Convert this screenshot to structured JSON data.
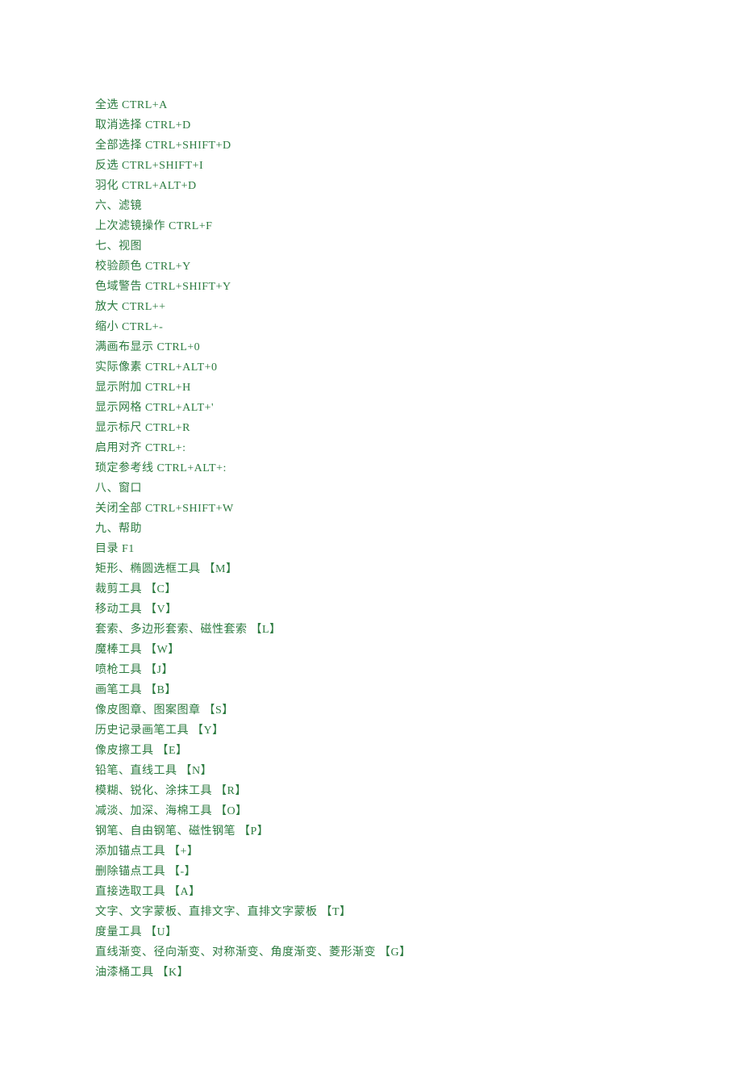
{
  "lines": [
    "全选 CTRL+A",
    "取消选择 CTRL+D",
    "全部选择 CTRL+SHIFT+D",
    "反选 CTRL+SHIFT+I",
    "羽化 CTRL+ALT+D",
    "六、滤镜",
    "上次滤镜操作 CTRL+F",
    "七、视图",
    "校验颜色 CTRL+Y",
    "色域警告 CTRL+SHIFT+Y",
    "放大 CTRL++",
    "缩小 CTRL+-",
    "满画布显示 CTRL+0",
    "实际像素 CTRL+ALT+0",
    "显示附加 CTRL+H",
    "显示网格 CTRL+ALT+'",
    "显示标尺 CTRL+R",
    "启用对齐 CTRL+:",
    "琐定参考线 CTRL+ALT+:",
    "八、窗口",
    "关闭全部 CTRL+SHIFT+W",
    "九、帮助",
    "目录 F1",
    "矩形、椭圆选框工具 【M】",
    "裁剪工具 【C】",
    "移动工具 【V】",
    "套索、多边形套索、磁性套索 【L】",
    "魔棒工具 【W】",
    "喷枪工具 【J】",
    "画笔工具 【B】",
    "像皮图章、图案图章 【S】",
    "历史记录画笔工具 【Y】",
    "像皮擦工具 【E】",
    "铅笔、直线工具 【N】",
    "模糊、锐化、涂抹工具 【R】",
    "减淡、加深、海棉工具 【O】",
    "钢笔、自由钢笔、磁性钢笔 【P】",
    "添加锚点工具 【+】",
    "删除锚点工具 【-】",
    "直接选取工具 【A】",
    "文字、文字蒙板、直排文字、直排文字蒙板 【T】",
    "度量工具 【U】",
    "直线渐变、径向渐变、对称渐变、角度渐变、菱形渐变 【G】",
    "油漆桶工具 【K】"
  ]
}
